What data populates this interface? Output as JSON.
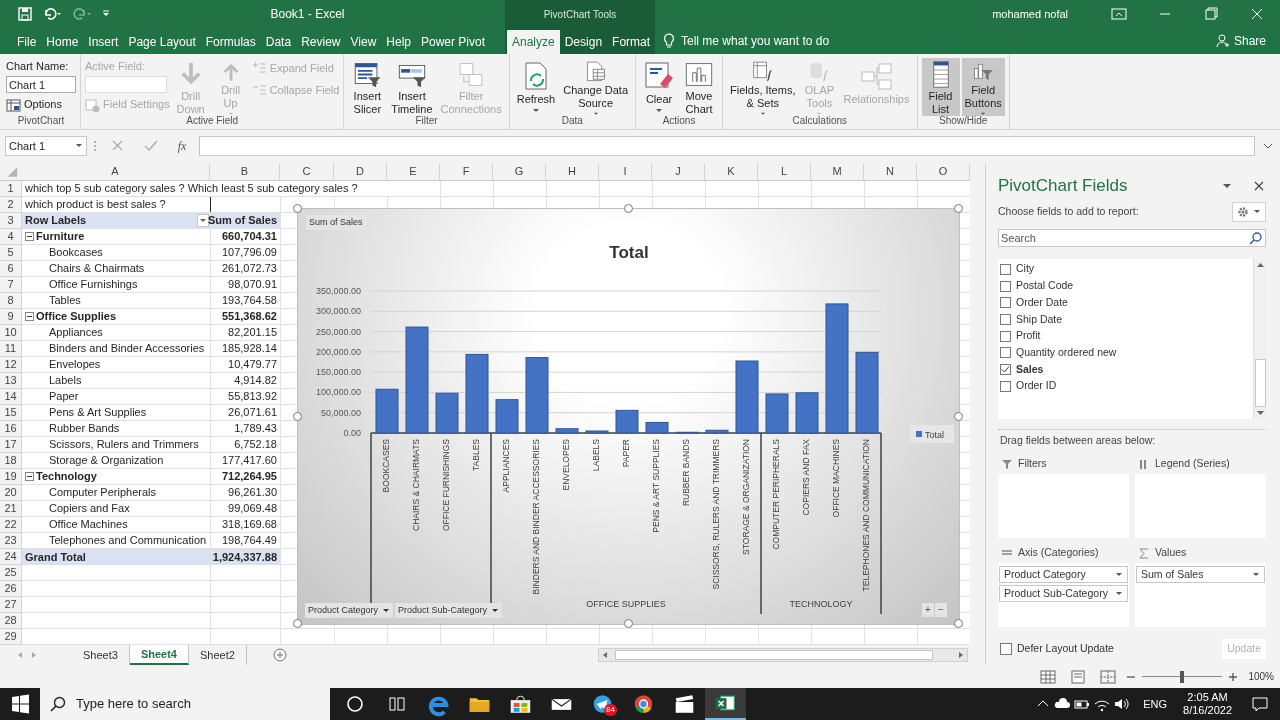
{
  "title_bar": {
    "title": "Book1 - Excel",
    "context_title": "PivotChart Tools",
    "user": "mohamed nofal"
  },
  "tabs": [
    {
      "label": "File",
      "selected": false,
      "contextual": false
    },
    {
      "label": "Home",
      "selected": false,
      "contextual": false
    },
    {
      "label": "Insert",
      "selected": false,
      "contextual": false
    },
    {
      "label": "Page Layout",
      "selected": false,
      "contextual": false
    },
    {
      "label": "Formulas",
      "selected": false,
      "contextual": false
    },
    {
      "label": "Data",
      "selected": false,
      "contextual": false
    },
    {
      "label": "Review",
      "selected": false,
      "contextual": false
    },
    {
      "label": "View",
      "selected": false,
      "contextual": false
    },
    {
      "label": "Help",
      "selected": false,
      "contextual": false
    },
    {
      "label": "Power Pivot",
      "selected": false,
      "contextual": false
    },
    {
      "label": "Analyze",
      "selected": true,
      "contextual": true
    },
    {
      "label": "Design",
      "selected": false,
      "contextual": true
    },
    {
      "label": "Format",
      "selected": false,
      "contextual": true
    }
  ],
  "tell_me": "Tell me what you want to do",
  "share": "Share",
  "ribbon": {
    "groups": [
      {
        "label": "PivotChart",
        "columns": [
          [
            {
              "kind": "caption",
              "label": "Chart Name:",
              "disabled": false
            },
            {
              "kind": "input",
              "value": "Chart 1",
              "disabled": false
            },
            {
              "kind": "small",
              "label": "Options",
              "disabled": false
            }
          ]
        ]
      },
      {
        "label": "Active Field",
        "columns": [
          [
            {
              "kind": "caption",
              "label": "Active Field:",
              "disabled": true
            },
            {
              "kind": "input",
              "disabled": true
            },
            {
              "kind": "small",
              "label": "Field Settings",
              "disabled": true
            }
          ],
          [
            {
              "kind": "large",
              "lines": [
                "Drill",
                "Down"
              ],
              "disabled": true,
              "dropdown": false,
              "on": false
            }
          ],
          [
            {
              "kind": "large",
              "lines": [
                "Drill",
                "Up"
              ],
              "disabled": true,
              "dropdown": true,
              "on": false
            }
          ],
          [
            {
              "kind": "small",
              "label": "Expand Field",
              "disabled": true
            },
            {
              "kind": "small",
              "label": "Collapse Field",
              "disabled": true
            }
          ]
        ]
      },
      {
        "label": "Filter",
        "columns": [
          [
            {
              "kind": "large",
              "lines": [
                "Insert",
                "Slicer"
              ],
              "disabled": false,
              "dropdown": false,
              "on": false
            }
          ],
          [
            {
              "kind": "large",
              "lines": [
                "Insert",
                "Timeline"
              ],
              "disabled": false,
              "dropdown": false,
              "on": false
            }
          ],
          [
            {
              "kind": "large",
              "lines": [
                "Filter",
                "Connections"
              ],
              "disabled": true,
              "dropdown": false,
              "on": false
            }
          ]
        ]
      },
      {
        "label": "Data",
        "columns": [
          [
            {
              "kind": "large",
              "lines": [
                "Refresh"
              ],
              "disabled": false,
              "dropdown": true,
              "on": false
            }
          ],
          [
            {
              "kind": "large",
              "lines": [
                "Change Data",
                "Source"
              ],
              "disabled": false,
              "dropdown": true,
              "on": false
            }
          ]
        ]
      },
      {
        "label": "Actions",
        "columns": [
          [
            {
              "kind": "large",
              "lines": [
                "Clear"
              ],
              "disabled": false,
              "dropdown": true,
              "on": false
            }
          ],
          [
            {
              "kind": "large",
              "lines": [
                "Move",
                "Chart"
              ],
              "disabled": false,
              "dropdown": false,
              "on": false
            }
          ]
        ]
      },
      {
        "label": "Calculations",
        "columns": [
          [
            {
              "kind": "large",
              "lines": [
                "Fields, Items,",
                "& Sets"
              ],
              "disabled": false,
              "dropdown": true,
              "on": false
            }
          ],
          [
            {
              "kind": "large",
              "lines": [
                "OLAP",
                "Tools"
              ],
              "disabled": true,
              "dropdown": true,
              "on": false
            }
          ],
          [
            {
              "kind": "large",
              "lines": [
                "Relationships"
              ],
              "disabled": true,
              "dropdown": false,
              "on": false
            }
          ]
        ]
      },
      {
        "label": "Show/Hide",
        "columns": [
          [
            {
              "kind": "large",
              "lines": [
                "Field",
                "List"
              ],
              "disabled": false,
              "dropdown": false,
              "on": true
            }
          ],
          [
            {
              "kind": "large",
              "lines": [
                "Field",
                "Buttons"
              ],
              "disabled": false,
              "dropdown": true,
              "on": true
            }
          ]
        ]
      }
    ]
  },
  "formula_bar": {
    "name_box": "Chart 1",
    "function_button": "fx"
  },
  "sheet": {
    "columns": [
      "A",
      "B",
      "C",
      "D",
      "E",
      "F",
      "G",
      "H",
      "I",
      "J",
      "K",
      "L",
      "M",
      "N",
      "O"
    ],
    "rows": [
      "1",
      "2",
      "3",
      "4",
      "5",
      "6",
      "7",
      "8",
      "9",
      "10",
      "11",
      "12",
      "13",
      "14",
      "15",
      "16",
      "17",
      "18",
      "19",
      "20",
      "21",
      "22",
      "23",
      "24",
      "25",
      "26",
      "27",
      "28",
      "29"
    ],
    "notes": [
      "which top 5 sub category sales ? Which least 5 sub category sales ?",
      "which product is best sales ?"
    ],
    "pivot": {
      "row_header": "Row Labels",
      "value_header": "Sum of Sales",
      "groups": [
        {
          "label": "Furniture",
          "total": "660,704.31",
          "expanded": true,
          "children": [
            {
              "label": "Bookcases",
              "value": "107,796.09"
            },
            {
              "label": "Chairs & Chairmats",
              "value": "261,072.73"
            },
            {
              "label": "Office Furnishings",
              "value": "98,070.91"
            },
            {
              "label": "Tables",
              "value": "193,764.58"
            }
          ]
        },
        {
          "label": "Office Supplies",
          "total": "551,368.62",
          "expanded": true,
          "children": [
            {
              "label": "Appliances",
              "value": "82,201.15"
            },
            {
              "label": "Binders and Binder Accessories",
              "value": "185,928.14"
            },
            {
              "label": "Envelopes",
              "value": "10,479.77"
            },
            {
              "label": "Labels",
              "value": "4,914.82"
            },
            {
              "label": "Paper",
              "value": "55,813.92"
            },
            {
              "label": "Pens & Art Supplies",
              "value": "26,071.61"
            },
            {
              "label": "Rubber Bands",
              "value": "1,789.43"
            },
            {
              "label": "Scissors, Rulers and Trimmers",
              "value": "6,752.18"
            },
            {
              "label": "Storage & Organization",
              "value": "177,417.60"
            }
          ]
        },
        {
          "label": "Technology",
          "total": "712,264.95",
          "expanded": true,
          "children": [
            {
              "label": "Computer Peripherals",
              "value": "96,261.30"
            },
            {
              "label": "Copiers and Fax",
              "value": "99,069.48"
            },
            {
              "label": "Office Machines",
              "value": "318,169.68"
            },
            {
              "label": "Telephones and Communication",
              "value": "198,764.49"
            }
          ]
        }
      ],
      "grand_total": {
        "label": "Grand Total",
        "value": "1,924,337.88"
      }
    }
  },
  "chart": {
    "value_button": "Sum of Sales",
    "axis_buttons": [
      "Product Category",
      "Product Sub-Category"
    ],
    "group_labels": [
      "OFFICE SUPPLIES",
      "TECHNOLOGY"
    ],
    "expand_buttons": [
      "+",
      "−"
    ],
    "chart_data": {
      "type": "bar",
      "title": "Total",
      "grid": true,
      "categories": [
        "BOOKCASES",
        "CHAIRS & CHAIRMATS",
        "OFFICE FURNISHINGS",
        "TABLES",
        "APPLIANCES",
        "BINDERS AND BINDER ACCESSORIES",
        "ENVELOPES",
        "LABELS",
        "PAPER",
        "PENS & ART SUPPLIES",
        "RUBBER BANDS",
        "SCISSORS, RULERS AND TRIMMERS",
        "STORAGE & ORGANIZATION",
        "COMPUTER PERIPHERALS",
        "COPIERS AND FAX",
        "OFFICE MACHINES",
        "TELEPHONES AND COMMUNICATION"
      ],
      "series": [
        {
          "name": "Total",
          "color": "#4472c4",
          "values": [
            107796.09,
            261072.73,
            98070.91,
            193764.58,
            82201.15,
            185928.14,
            10479.77,
            4914.82,
            55813.92,
            26071.61,
            1789.43,
            6752.18,
            177417.6,
            96261.3,
            99069.48,
            318169.68,
            198764.49
          ]
        }
      ],
      "ylim": [
        0,
        350000
      ],
      "yticks": [
        {
          "value": 0,
          "label": "0.00"
        },
        {
          "value": 50000,
          "label": "50,000.00"
        },
        {
          "value": 100000,
          "label": "100,000.00"
        },
        {
          "value": 150000,
          "label": "150,000.00"
        },
        {
          "value": 200000,
          "label": "200,000.00"
        },
        {
          "value": 250000,
          "label": "250,000.00"
        },
        {
          "value": 300000,
          "label": "300,000.00"
        },
        {
          "value": 350000,
          "label": "350,000.00"
        }
      ]
    }
  },
  "field_panel": {
    "title": "PivotChart Fields",
    "subtitle": "Choose fields to add to report:",
    "search": {
      "placeholder": "Search"
    },
    "fields": [
      {
        "label": "City",
        "checked": false
      },
      {
        "label": "Postal Code",
        "checked": false
      },
      {
        "label": "Order Date",
        "checked": false
      },
      {
        "label": "Ship Date",
        "checked": false
      },
      {
        "label": "Profit",
        "checked": false
      },
      {
        "label": "Quantity ordered new",
        "checked": false
      },
      {
        "label": "Sales",
        "checked": true
      },
      {
        "label": "Order ID",
        "checked": false
      }
    ],
    "areas_hint": "Drag fields between areas below:",
    "areas": [
      {
        "kind": "filters",
        "label": "Filters"
      },
      {
        "kind": "legend",
        "label": "Legend (Series)"
      },
      {
        "kind": "axis",
        "label": "Axis (Categories)",
        "items": [
          "Product Category",
          "Product Sub-Category"
        ]
      },
      {
        "kind": "values",
        "label": "Values",
        "items": [
          "Sum of Sales"
        ]
      }
    ],
    "defer": {
      "label": "Defer Layout Update",
      "checked": false
    },
    "update": {
      "label": "Update",
      "disabled": true
    }
  },
  "sheet_tabs": [
    {
      "label": "Sheet3",
      "selected": false
    },
    {
      "label": "Sheet4",
      "selected": true
    },
    {
      "label": "Sheet2",
      "selected": false
    }
  ],
  "status_bar": {
    "zoom": "100%",
    "zoom_slider": {
      "level": 0.5
    }
  },
  "taskbar": {
    "search": {
      "placeholder": "Type here to search"
    },
    "apps": [
      {
        "active": false
      },
      {
        "active": false
      },
      {
        "active": false
      },
      {
        "active": false
      },
      {
        "active": false,
        "badge": "84"
      },
      {
        "active": false
      },
      {
        "active": false
      },
      {
        "active": true
      }
    ],
    "language": "ENG",
    "time": "2:05 AM",
    "date": "8/16/2022"
  }
}
